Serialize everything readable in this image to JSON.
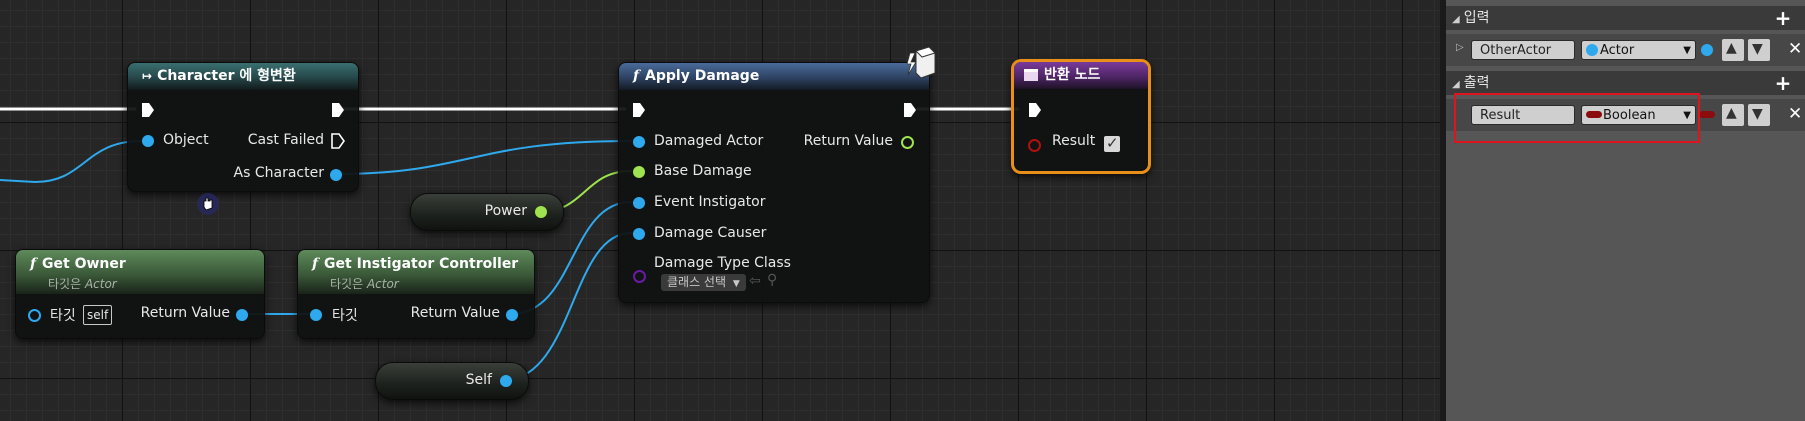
{
  "graph": {
    "cast_node": {
      "title": "Character 에 형변환",
      "pin_object": "Object",
      "pin_cast_failed": "Cast Failed",
      "pin_as_character": "As Character"
    },
    "apply_damage": {
      "title": "Apply Damage",
      "pin_damaged_actor": "Damaged Actor",
      "pin_base_damage": "Base Damage",
      "pin_event_instigator": "Event Instigator",
      "pin_damage_causer": "Damage Causer",
      "pin_damage_type_class": "Damage Type Class",
      "class_select": "클래스 선택",
      "pin_return_value": "Return Value"
    },
    "return_node": {
      "title": "반환 노드",
      "pin_result": "Result"
    },
    "get_owner": {
      "title": "Get Owner",
      "subtitle_prefix": "타깃은",
      "subtitle_type": "Actor",
      "pin_target": "타깃",
      "self_label": "self",
      "pin_return_value": "Return Value"
    },
    "get_instigator": {
      "title": "Get Instigator Controller",
      "subtitle_prefix": "타깃은",
      "subtitle_type": "Actor",
      "pin_target": "타깃",
      "pin_return_value": "Return Value"
    },
    "power_var": {
      "label": "Power"
    },
    "self_var": {
      "label": "Self"
    }
  },
  "panel": {
    "inputs": {
      "title": "입력",
      "param_name": "OtherActor",
      "param_type": "Actor"
    },
    "outputs": {
      "title": "출력",
      "param_name": "Result",
      "param_type": "Boolean"
    }
  },
  "colors": {
    "object_pin": "#2fa9ee",
    "float_pin": "#9fe34f",
    "bool_pin": "#b01010",
    "class_pin": "#6a1aa8",
    "highlight": "#e0141e",
    "return_border": "#e88f1a"
  }
}
